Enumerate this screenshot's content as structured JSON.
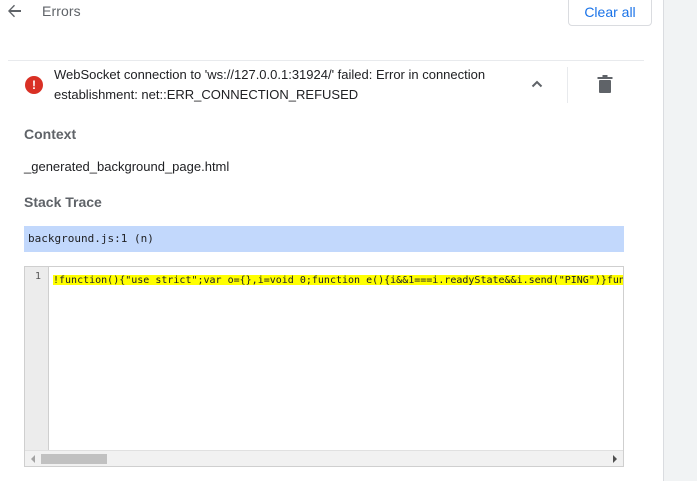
{
  "header": {
    "title": "Errors",
    "clear_all_label": "Clear all",
    "back_icon": "arrow-back-icon"
  },
  "error": {
    "message": "WebSocket connection to 'ws://127.0.0.1:31924/' failed: Error in connection establishment: net::ERR_CONNECTION_REFUSED",
    "icon_glyph": "!",
    "icon": "error-icon",
    "expand_icon": "chevron-up-icon",
    "delete_icon": "trash-icon"
  },
  "context": {
    "heading": "Context",
    "value": "_generated_background_page.html"
  },
  "stack_trace": {
    "heading": "Stack Trace",
    "frame": "background.js:1 (n)"
  },
  "code": {
    "line_number": "1",
    "line_text": "!function(){\"use strict\";var o={},i=void 0;function e(){i&&1===i.readyState&&i.send(\"PING\")}function"
  },
  "colors": {
    "accent": "#1a73e8",
    "error": "#d93025",
    "trace_highlight": "#c2d8fc",
    "code_highlight": "#ffff00"
  }
}
